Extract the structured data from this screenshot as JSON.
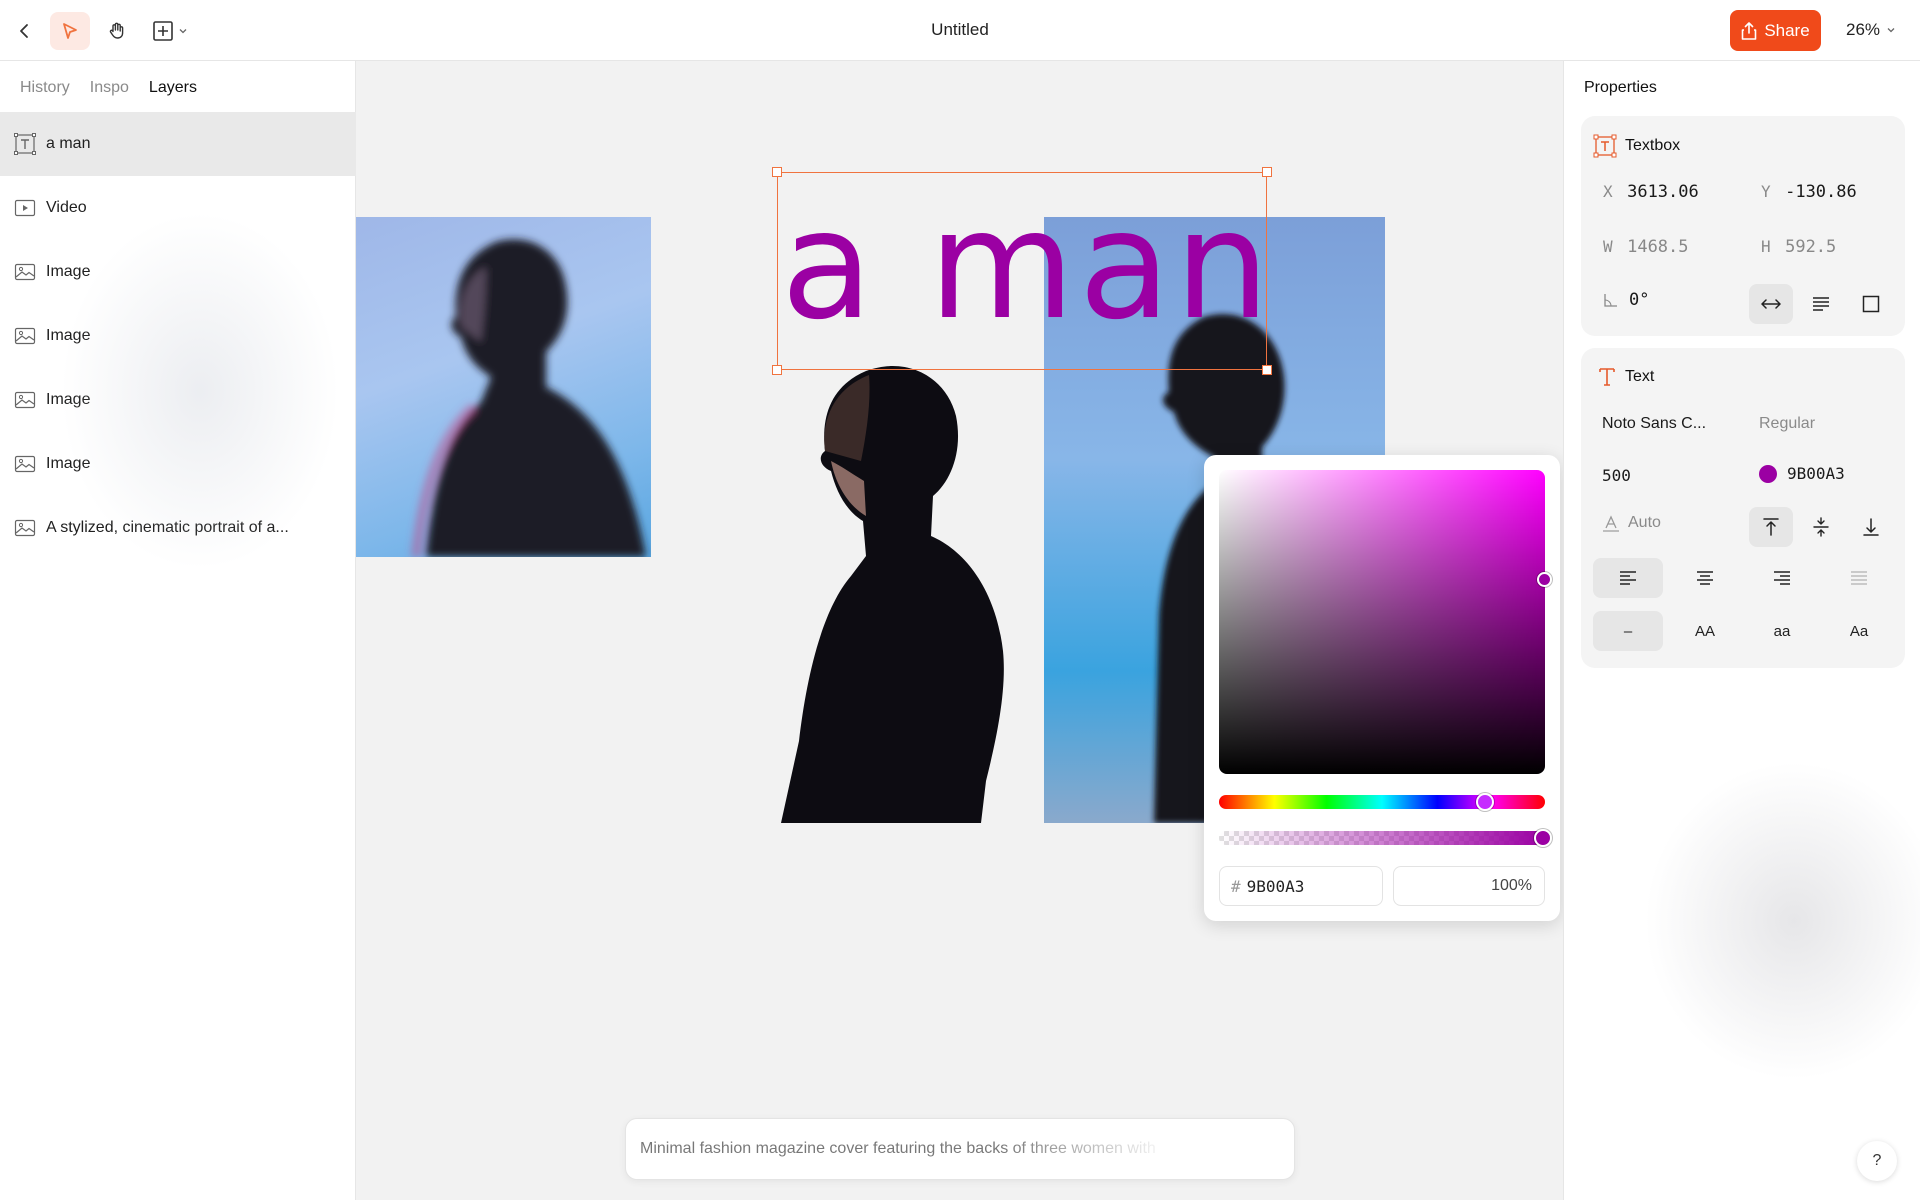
{
  "toolbar": {
    "doc_title": "Untitled",
    "share_label": "Share",
    "zoom": "26%",
    "icons": [
      "back-icon",
      "pointer-icon",
      "hand-icon",
      "add-frame-icon",
      "chevron-down-icon"
    ]
  },
  "left_panel": {
    "tabs": [
      "History",
      "Inspo",
      "Layers"
    ],
    "active_tab": "Layers",
    "layers": [
      {
        "label": "a man",
        "icon": "textbox-icon",
        "selected": true
      },
      {
        "label": "Video",
        "icon": "video-icon"
      },
      {
        "label": "Image",
        "icon": "image-icon"
      },
      {
        "label": "Image",
        "icon": "image-icon"
      },
      {
        "label": "Image",
        "icon": "image-icon"
      },
      {
        "label": "Image",
        "icon": "image-icon"
      },
      {
        "label": "A stylized, cinematic portrait of a...",
        "icon": "image-icon"
      }
    ]
  },
  "canvas": {
    "text": "a man",
    "text_color": "#9B00A3",
    "prompt_text": "Minimal fashion magazine cover featuring the backs of three women with"
  },
  "color_picker": {
    "hex_prefix": "#",
    "hex_value": "9B00A3",
    "opacity": "100%"
  },
  "properties": {
    "title": "Properties",
    "textbox": {
      "header": "Textbox",
      "x_label": "X",
      "x_value": "3613.06",
      "y_label": "Y",
      "y_value": "-130.86",
      "w_label": "W",
      "w_value": "1468.5",
      "h_label": "H",
      "h_value": "592.5",
      "rotation": "0°"
    },
    "text": {
      "header": "Text",
      "font_family": "Noto Sans C...",
      "font_style": "Regular",
      "font_weight": "500",
      "color_hex": "9B00A3",
      "line_height": "Auto",
      "case_options": [
        "–",
        "AA",
        "aa",
        "Aa"
      ]
    }
  },
  "help_label": "?"
}
